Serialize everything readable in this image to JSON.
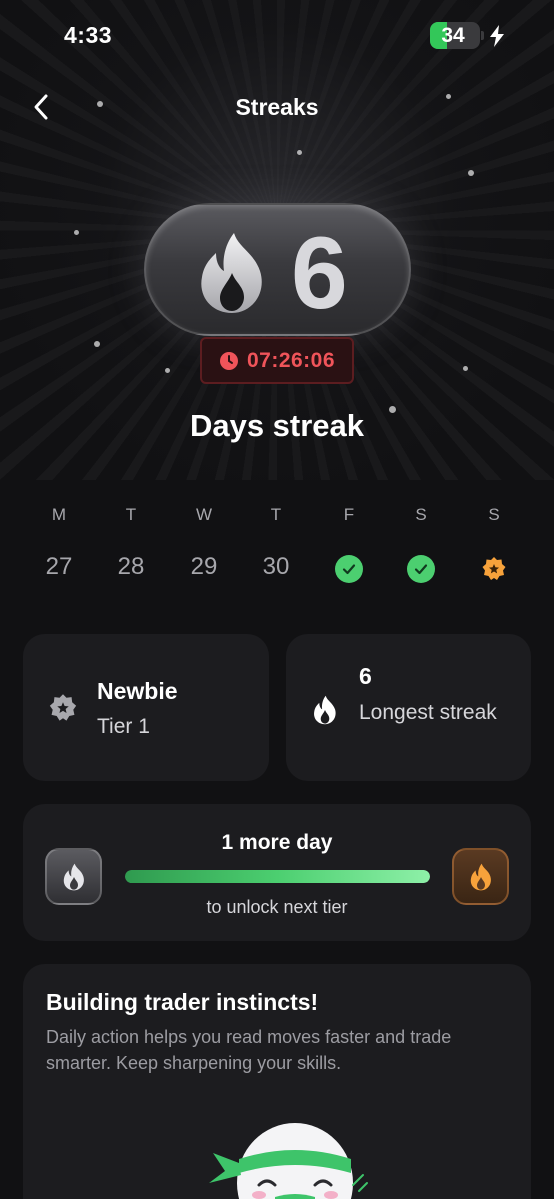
{
  "status_bar": {
    "time": "4:33",
    "battery": "34",
    "battery_level": 0.34
  },
  "nav": {
    "title": "Streaks",
    "back_icon": "chevron-left-icon"
  },
  "hero": {
    "streak_count": "6",
    "timer": "07:26:06",
    "label": "Days streak",
    "flame_icon": "flame-icon"
  },
  "week": [
    {
      "day": "M",
      "date": "27",
      "state": "none"
    },
    {
      "day": "T",
      "date": "28",
      "state": "none"
    },
    {
      "day": "W",
      "date": "29",
      "state": "none"
    },
    {
      "day": "T",
      "date": "30",
      "state": "none"
    },
    {
      "day": "F",
      "state": "done"
    },
    {
      "day": "S",
      "state": "done"
    },
    {
      "day": "S",
      "state": "today"
    }
  ],
  "tier": {
    "name": "Newbie",
    "level": "Tier 1"
  },
  "longest": {
    "value": "6",
    "label": "Longest streak"
  },
  "progress": {
    "title": "1 more day",
    "subtitle": "to unlock next tier",
    "fraction": 1.0
  },
  "info": {
    "title": "Building trader instincts!",
    "body": "Daily action helps you read moves faster and trade smarter. Keep sharpening your skills."
  },
  "colors": {
    "accent_green": "#4ccf70",
    "timer_red": "#f0545a",
    "today_orange": "#f7a23b",
    "background": "#111113",
    "card": "#1c1c1f"
  }
}
